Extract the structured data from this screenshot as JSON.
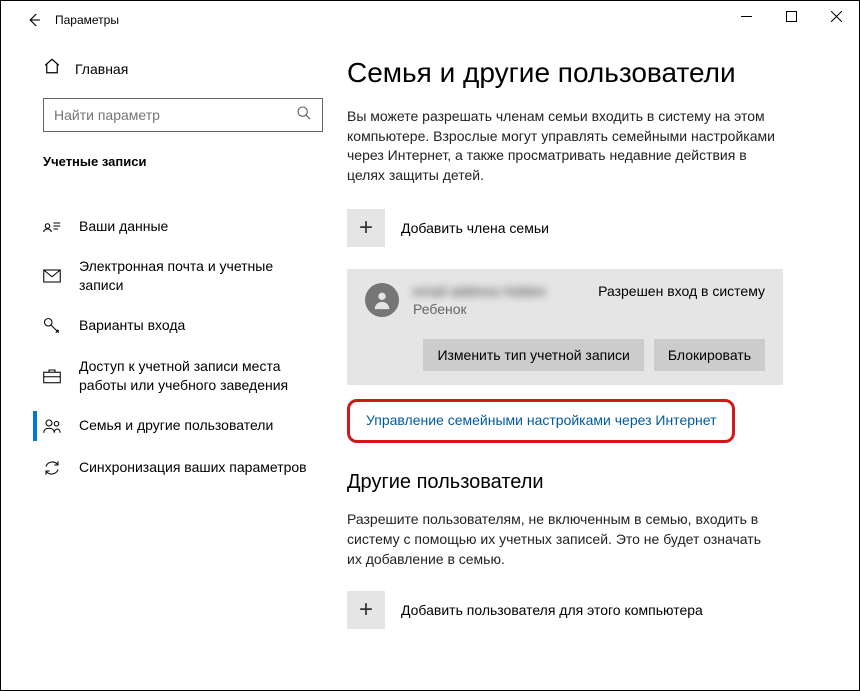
{
  "title": "Параметры",
  "home_label": "Главная",
  "search_placeholder": "Найти параметр",
  "group_title": "Учетные записи",
  "nav": [
    {
      "label": "Ваши данные"
    },
    {
      "label": "Электронная почта и учетные записи"
    },
    {
      "label": "Варианты входа"
    },
    {
      "label": "Доступ к учетной записи места работы или учебного заведения"
    },
    {
      "label": "Семья и другие пользователи"
    },
    {
      "label": "Синхронизация ваших параметров"
    }
  ],
  "page": {
    "heading": "Семья и другие пользователи",
    "desc": "Вы можете разрешать членам семьи входить в систему на этом компьютере. Взрослые могут управлять семейными настройками через Интернет, а также просматривать недавние действия в целях защиты детей.",
    "add_family_label": "Добавить члена семьи",
    "member": {
      "email": "email address hidden",
      "role": "Ребенок",
      "status": "Разрешен вход в систему",
      "change_type_btn": "Изменить тип учетной записи",
      "block_btn": "Блокировать"
    },
    "manage_link": "Управление семейными настройками через Интернет",
    "others_heading": "Другие пользователи",
    "others_desc": "Разрешите пользователям, не включенным в семью, входить в систему с помощью их учетных записей. Это не будет означать их добавление в семью.",
    "add_other_label": "Добавить пользователя для этого компьютера"
  }
}
